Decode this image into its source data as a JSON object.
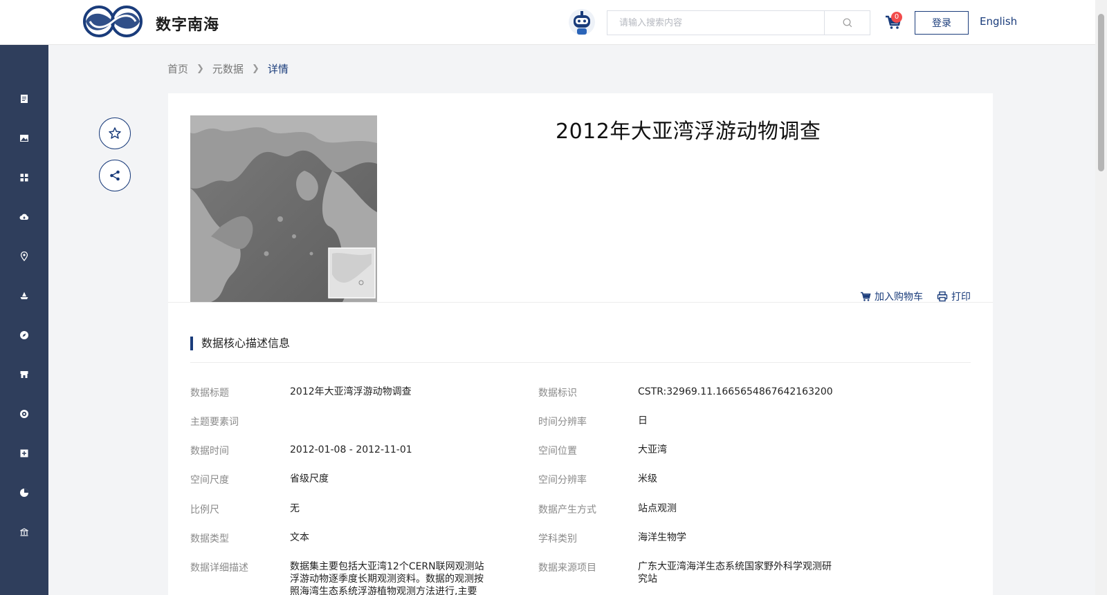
{
  "header": {
    "brand": "数字南海",
    "search_placeholder": "请输入搜索内容",
    "cart_count": "0",
    "login_label": "登录",
    "language_label": "English"
  },
  "sidebar": {
    "icons": [
      "document-icon",
      "image-icon",
      "grid-icon",
      "cloud-upload-icon",
      "location-pin-icon",
      "ship-icon",
      "compass-icon",
      "store-icon",
      "target-icon",
      "plus-square-icon",
      "pie-chart-icon",
      "building-icon"
    ]
  },
  "breadcrumb": {
    "home": "首页",
    "level2": "元数据",
    "current": "详情"
  },
  "detail": {
    "title": "2012年大亚湾浮游动物调查",
    "add_to_cart": "加入购物车",
    "print": "打印"
  },
  "core_info": {
    "section_title": "数据核心描述信息",
    "rows": [
      {
        "l1": "数据标题",
        "v1": "2012年大亚湾浮游动物调查",
        "l2": "数据标识",
        "v2": "CSTR:32969.11.1665654867642163200"
      },
      {
        "l1": "主题要素词",
        "v1": "",
        "l2": "时间分辨率",
        "v2": "日"
      },
      {
        "l1": "数据时间",
        "v1": "2012-01-08 - 2012-11-01",
        "l2": "空间位置",
        "v2": "大亚湾"
      },
      {
        "l1": "空间尺度",
        "v1": "省级尺度",
        "l2": "空间分辨率",
        "v2": "米级"
      },
      {
        "l1": "比例尺",
        "v1": "无",
        "l2": "数据产生方式",
        "v2": "站点观测"
      },
      {
        "l1": "数据类型",
        "v1": "文本",
        "l2": "学科类别",
        "v2": "海洋生物学"
      },
      {
        "l1": "数据详细描述",
        "v1": "数据集主要包括大亚湾12个CERN联网观测站浮游动物逐季度长期观测资料。数据的观测按照海湾生态系统浮游植物观测方法进行,主要",
        "l2": "数据来源项目",
        "v2": "广东大亚湾海洋生态系统国家野外科学观测研究站"
      }
    ]
  },
  "colors": {
    "primary": "#1a3c7b",
    "sidebar": "#2f3e5c",
    "badge": "#f24c4c"
  }
}
